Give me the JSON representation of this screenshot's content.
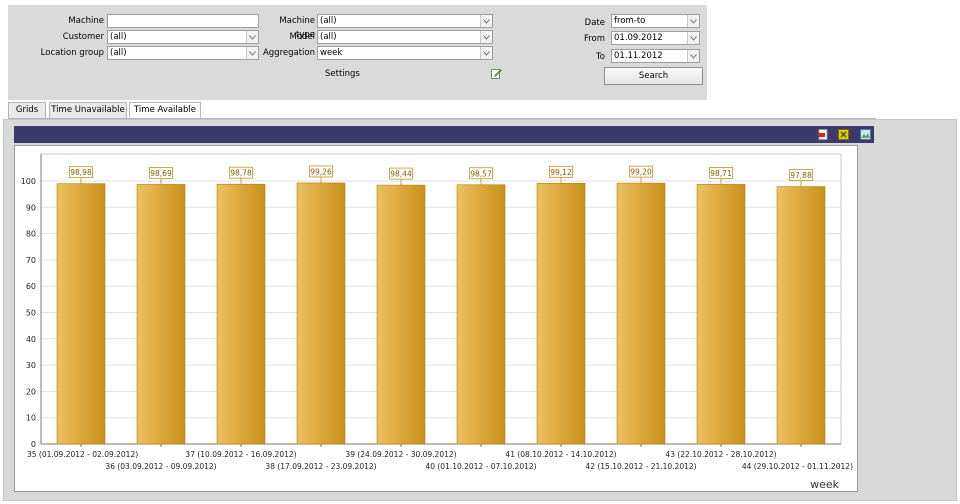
{
  "filters": {
    "machine": {
      "label": "Machine",
      "value": ""
    },
    "customer": {
      "label": "Customer",
      "value": "(all)"
    },
    "location_group": {
      "label": "Location group",
      "value": "(all)"
    },
    "machine_type": {
      "label": "Machine type",
      "value": "(all)"
    },
    "model": {
      "label": "Model",
      "value": "(all)"
    },
    "aggregation": {
      "label": "Aggregation",
      "value": "week"
    },
    "settings_label": "Settings",
    "date": {
      "label": "Date",
      "value": "from-to"
    },
    "from": {
      "label": "From",
      "value": "01.09.2012"
    },
    "to": {
      "label": "To",
      "value": "01.11.2012"
    },
    "search_label": "Search"
  },
  "tabs": [
    {
      "label": "Grids",
      "active": false
    },
    {
      "label": "Time Unavailable",
      "active": false
    },
    {
      "label": "Time Available",
      "active": true
    }
  ],
  "toolbar_icons": [
    "pdf-export-icon",
    "excel-export-icon",
    "image-export-icon"
  ],
  "colors": {
    "bar_light": "#f0c060",
    "bar_dark": "#c8901a",
    "header_bar": "#3b3b6b",
    "panel": "#dadada"
  },
  "chart_data": {
    "type": "bar",
    "categories": [
      "35 (01.09.2012 - 02.09.2012)",
      "36 (03.09.2012 - 09.09.2012)",
      "37 (10.09.2012 - 16.09.2012)",
      "38 (17.09.2012 - 23.09.2012)",
      "39 (24.09.2012 - 30.09.2012)",
      "40 (01.10.2012 - 07.10.2012)",
      "41 (08.10.2012 - 14.10.2012)",
      "42 (15.10.2012 - 21.10.2012)",
      "43 (22.10.2012 - 28.10.2012)",
      "44 (29.10.2012 - 01.11.2012)"
    ],
    "values": [
      98.98,
      98.69,
      98.78,
      99.26,
      98.44,
      98.57,
      99.12,
      99.2,
      98.71,
      97.88
    ],
    "value_labels": [
      "98,98",
      "98,69",
      "98,78",
      "99,26",
      "98,44",
      "98,57",
      "99,12",
      "99,20",
      "98,71",
      "97,88"
    ],
    "y_ticks": [
      "0",
      "10",
      "20",
      "30",
      "40",
      "50",
      "60",
      "70",
      "80",
      "90",
      "100"
    ],
    "ylim": [
      0,
      100
    ],
    "xlabel": "week",
    "ylabel": "",
    "title": "",
    "grid": true
  }
}
